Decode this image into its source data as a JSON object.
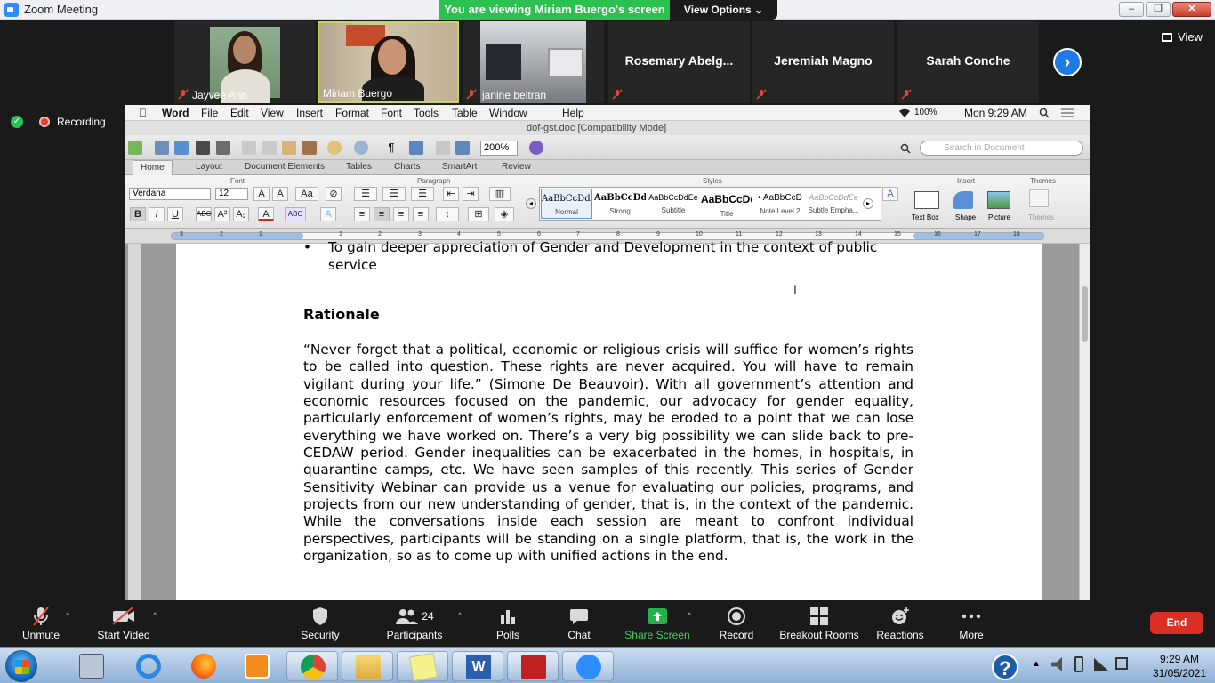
{
  "window": {
    "title": "Zoom Meeting",
    "minimize": "–",
    "restore": "❐",
    "close": "✕"
  },
  "banner": {
    "viewing": "You are viewing Miriam Buergo's screen",
    "view_options": "View Options ⌄"
  },
  "participants": [
    {
      "name": "Jayvee Ann"
    },
    {
      "name": "Miriam Buergo"
    },
    {
      "name": "janine beltran"
    },
    {
      "name": "Rosemary  Abelg..."
    },
    {
      "name": "Jeremiah Magno"
    },
    {
      "name": "Sarah Conche"
    }
  ],
  "top_controls": {
    "view": "View",
    "next": "›"
  },
  "recording": {
    "label": "Recording"
  },
  "mac_menu": {
    "apple": "",
    "app": "Word",
    "items": [
      "File",
      "Edit",
      "View",
      "Insert",
      "Format",
      "Font",
      "Tools",
      "Table",
      "Window",
      "Help"
    ],
    "battery": "100%",
    "clock": "Mon 9:29 AM"
  },
  "document": {
    "title": "dof-gst.doc [Compatibility Mode]",
    "zoom": "200%",
    "search_placeholder": "Search in Document"
  },
  "ribbon_tabs": [
    "Home",
    "Layout",
    "Document Elements",
    "Tables",
    "Charts",
    "SmartArt",
    "Review"
  ],
  "ribbon": {
    "groups": {
      "font": "Font",
      "paragraph": "Paragraph",
      "styles": "Styles",
      "insert": "Insert",
      "themes": "Themes"
    },
    "font_name": "Verdana",
    "font_size": "12",
    "styles": [
      {
        "sample": "AaBbCcDdE",
        "label": "Normal"
      },
      {
        "sample": "AaBbCcDdI",
        "label": "Strong"
      },
      {
        "sample": "AaBbCcDdEe",
        "label": "Subtitle"
      },
      {
        "sample": "AaBbCcDd",
        "label": "Title"
      },
      {
        "sample": "• AaBbCcD",
        "label": "Note Level 2"
      },
      {
        "sample": "AaBbCcDdEe",
        "label": "Subtle Empha..."
      }
    ],
    "insert": [
      "Text Box",
      "Shape",
      "Picture"
    ],
    "themes": "Themes"
  },
  "ruler_ticks": [
    "3",
    "2",
    "1",
    "",
    "1",
    "2",
    "3",
    "4",
    "5",
    "6",
    "7",
    "8",
    "9",
    "10",
    "11",
    "12",
    "13",
    "14",
    "15",
    "16",
    "17",
    "18"
  ],
  "page": {
    "bullet": "To gain deeper appreciation of Gender and Development in the context of public service",
    "heading": "Rationale",
    "paragraph": "“Never forget that a political, economic or religious crisis will suffice for women’s rights to be called into question. These rights are never acquired. You will have to remain vigilant during your life.” (Simone De Beauvoir). With all government’s attention and economic resources focused on the pandemic, our advocacy for gender equality, particularly enforcement of women’s rights, may be eroded to a point that we can lose everything we have worked on. There’s a very big possibility we can slide back to pre-CEDAW period. Gender inequalities can be exacerbated in the homes, in hospitals, in quarantine camps, etc. We have seen samples of this recently. This series of Gender Sensitivity Webinar can provide us a venue for evaluating our policies, programs, and projects from our new understanding of gender, that is, in the context of the pandemic. While the conversations inside each session are meant to confront individual perspectives, participants will be standing on a single platform, that is, the work in the organization, so as to come up with unified actions in the end."
  },
  "controls": {
    "unmute": "Unmute",
    "start_video": "Start Video",
    "security": "Security",
    "participants": "Participants",
    "participants_count": "24",
    "polls": "Polls",
    "chat": "Chat",
    "share_screen": "Share Screen",
    "record": "Record",
    "breakout": "Breakout Rooms",
    "reactions": "Reactions",
    "more": "More",
    "end": "End"
  },
  "taskbar": {
    "time": "9:29 AM",
    "date": "31/05/2021"
  },
  "colors": {
    "share_green": "#2bc04f",
    "end_red": "#d93025",
    "zoom_blue": "#2d8cff",
    "active_tile": "#c4d94f"
  }
}
